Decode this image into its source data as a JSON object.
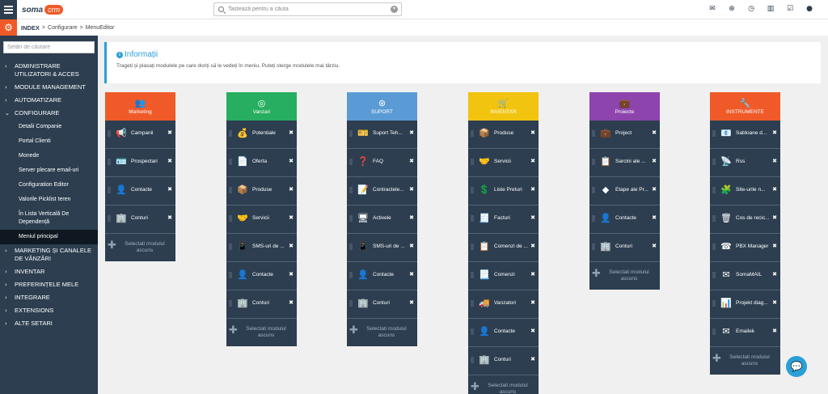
{
  "app": {
    "logo_a": "soma",
    "logo_b": "crm"
  },
  "search": {
    "placeholder": "Tastează pentru a căuta"
  },
  "top_icons": [
    "mail-icon",
    "plus-circle-icon",
    "clock-icon",
    "bar-chart-icon",
    "checkbox-icon",
    "user-icon"
  ],
  "breadcrumb": {
    "index": "INDEX",
    "sep1": ">",
    "configure": "Configurare",
    "sep2": ">",
    "current": "MenuEditor"
  },
  "sidebar": {
    "search_placeholder": "Setări de căutare",
    "menu": [
      {
        "label": "ADMINISTRARE UTILIZATORI & ACCES",
        "open": false
      },
      {
        "label": "MODULE MANAGEMENT",
        "open": false
      },
      {
        "label": "AUTOMATIZARE",
        "open": false
      },
      {
        "label": "CONFIGURARE",
        "open": true
      },
      {
        "label": "MARKETING ȘI CANALELE DE VÂNZĂRI",
        "open": false
      },
      {
        "label": "INVENTAR",
        "open": false
      },
      {
        "label": "PREFERINȚELE MELE",
        "open": false
      },
      {
        "label": "INTEGRARE",
        "open": false
      },
      {
        "label": "EXTENSIONS",
        "open": false
      },
      {
        "label": "ALTE SETARI",
        "open": false
      }
    ],
    "config_items": [
      "Detalii Companie",
      "Portal Clienti",
      "Monede",
      "Server plecare email-uri",
      "Configuration Editor",
      "Valorile Picklist teren",
      "În Lista Verticală De Dependență",
      "Meniul principal"
    ]
  },
  "info": {
    "title": "Informații",
    "text": "Trageți și plasați modulele pe care doriți să le vedeți în meniu. Puteți sterge modulele mai târziu."
  },
  "hidden_label": "Selectati modulul ascuns",
  "colors": {
    "marketing": "#f05a28",
    "vanzari": "#27ae60",
    "suport": "#5b9bd5",
    "inventar": "#f1c40f",
    "proiecte": "#8e44ad",
    "instrumente": "#f05a28",
    "dark": "#2c3e50"
  },
  "columns": [
    {
      "name": "Marketing",
      "icon": "users-icon",
      "items": [
        {
          "label": "Campanii",
          "icon": "megaphone-icon"
        },
        {
          "label": "Prospectari",
          "icon": "id-card-icon"
        },
        {
          "label": "Contacte",
          "icon": "user-icon"
        },
        {
          "label": "Conturi",
          "icon": "building-icon"
        }
      ]
    },
    {
      "name": "Vanzari",
      "icon": "target-icon",
      "items": [
        {
          "label": "Potentiale",
          "icon": "money-bag-icon"
        },
        {
          "label": "Oferta",
          "icon": "document-icon"
        },
        {
          "label": "Produse",
          "icon": "box-icon"
        },
        {
          "label": "Servicii",
          "icon": "handshake-icon"
        },
        {
          "label": "SMS-uri de ...",
          "icon": "phone-icon"
        },
        {
          "label": "Contacte",
          "icon": "user-icon"
        },
        {
          "label": "Conturi",
          "icon": "building-icon"
        }
      ]
    },
    {
      "name": "SUPORT",
      "icon": "lifebuoy-icon",
      "items": [
        {
          "label": "Suport Teh...",
          "icon": "ticket-icon"
        },
        {
          "label": "FAQ",
          "icon": "question-icon"
        },
        {
          "label": "Contractele...",
          "icon": "contract-icon"
        },
        {
          "label": "Activele",
          "icon": "assets-icon"
        },
        {
          "label": "SMS-uri de ...",
          "icon": "phone-icon"
        },
        {
          "label": "Contacte",
          "icon": "user-icon"
        },
        {
          "label": "Conturi",
          "icon": "building-icon"
        }
      ]
    },
    {
      "name": "INVENTAR",
      "icon": "cart-icon",
      "items": [
        {
          "label": "Produse",
          "icon": "box-icon"
        },
        {
          "label": "Servicii",
          "icon": "handshake-icon"
        },
        {
          "label": "Liste Preturi",
          "icon": "price-list-icon"
        },
        {
          "label": "Facturi",
          "icon": "invoice-icon"
        },
        {
          "label": "Comenzi de ...",
          "icon": "sales-order-icon"
        },
        {
          "label": "Comenzi",
          "icon": "purchase-order-icon"
        },
        {
          "label": "Vanzatori",
          "icon": "vendor-icon"
        },
        {
          "label": "Contacte",
          "icon": "user-icon"
        },
        {
          "label": "Conturi",
          "icon": "building-icon"
        }
      ]
    },
    {
      "name": "Proiecte",
      "icon": "briefcase-icon",
      "items": [
        {
          "label": "Project",
          "icon": "briefcase-icon"
        },
        {
          "label": "Sarcini ale ...",
          "icon": "clipboard-icon"
        },
        {
          "label": "Etape ale Pr...",
          "icon": "diamond-icon"
        },
        {
          "label": "Contacte",
          "icon": "user-icon"
        },
        {
          "label": "Conturi",
          "icon": "building-icon"
        }
      ]
    },
    {
      "name": "INSTRUMENTE",
      "icon": "wrench-icon",
      "items": [
        {
          "label": "Sabloane d...",
          "icon": "email-template-icon"
        },
        {
          "label": "Rss",
          "icon": "rss-icon"
        },
        {
          "label": "Site-urile n...",
          "icon": "puzzle-icon"
        },
        {
          "label": "Cos de recic...",
          "icon": "trash-icon"
        },
        {
          "label": "PBX Manager",
          "icon": "pbx-icon"
        },
        {
          "label": "SomaMAIL",
          "icon": "somamail-icon"
        },
        {
          "label": "Projekt diag...",
          "icon": "chart-icon"
        },
        {
          "label": "Emailek",
          "icon": "envelope-icon"
        }
      ]
    }
  ]
}
